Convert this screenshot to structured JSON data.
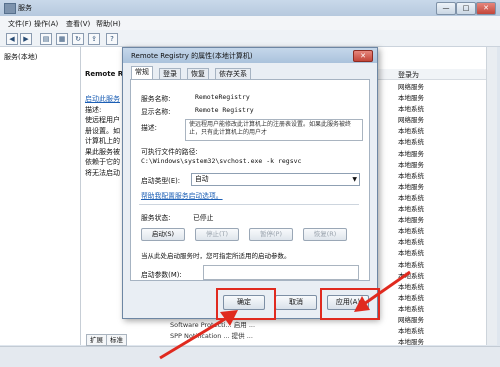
{
  "window": {
    "title": "服务",
    "min": "—",
    "max": "□",
    "close": "✕"
  },
  "menu": [
    "文件(F)",
    "操作(A)",
    "查看(V)",
    "帮助(H)"
  ],
  "tree": {
    "item": "服务(本地)"
  },
  "main": {
    "header": "Remote R",
    "desc_lines": [
      "启动此服务",
      "",
      "描述:",
      "使远程用户",
      "册设置。如",
      "计算机上的",
      "果此服务被",
      "依赖于它的",
      "将无法启动"
    ],
    "right_column_header": "登录为",
    "right_rows": [
      "网络服务",
      "本地服务",
      "本地系统",
      "网络服务",
      "本地系统",
      "本地系统",
      "本地服务",
      "本地服务",
      "本地系统",
      "本地服务",
      "本地系统",
      "本地系统",
      "本地服务",
      "本地系统",
      "本地系统",
      "本地系统",
      "本地系统",
      "本地系统",
      "本地系统",
      "本地系统",
      "本地系统",
      "网络服务",
      "本地系统",
      "本地服务"
    ],
    "bottom_rows": [
      "Software Protecti... 启用 ...",
      "SPP Notification ... 提供 ..."
    ]
  },
  "status_tabs": [
    "扩展",
    "标准"
  ],
  "dialog": {
    "title": "Remote Registry 的属性(本地计算机)",
    "tabs": [
      "常规",
      "登录",
      "恢复",
      "依存关系"
    ],
    "service_name_label": "服务名称:",
    "service_name": "RemoteRegistry",
    "display_name_label": "显示名称:",
    "display_name": "Remote Registry",
    "description_label": "描述:",
    "description": "使远程用户能修改此计算机上的注册表设置。如果此服务被终止，只有此计算机上的用户才",
    "exe_path_label": "可执行文件的路径:",
    "exe_path": "C:\\Windows\\system32\\svchost.exe -k regsvc",
    "startup_type_label": "启动类型(E):",
    "startup_type": "自动",
    "help_link": "帮助我配置服务启动选项。",
    "status_label": "服务状态:",
    "status_value": "已停止",
    "buttons": {
      "start": "启动(S)",
      "stop": "停止(T)",
      "pause": "暂停(P)",
      "resume": "恢复(R)"
    },
    "hint": "当从此处启动服务时，您可指定所适用的启动参数。",
    "param_label": "启动参数(M):",
    "param_value": "",
    "ok": "确定",
    "cancel": "取消",
    "apply": "应用(A)"
  },
  "colors": {
    "highlight": "#e02a1f",
    "link": "#1c5fb5"
  }
}
